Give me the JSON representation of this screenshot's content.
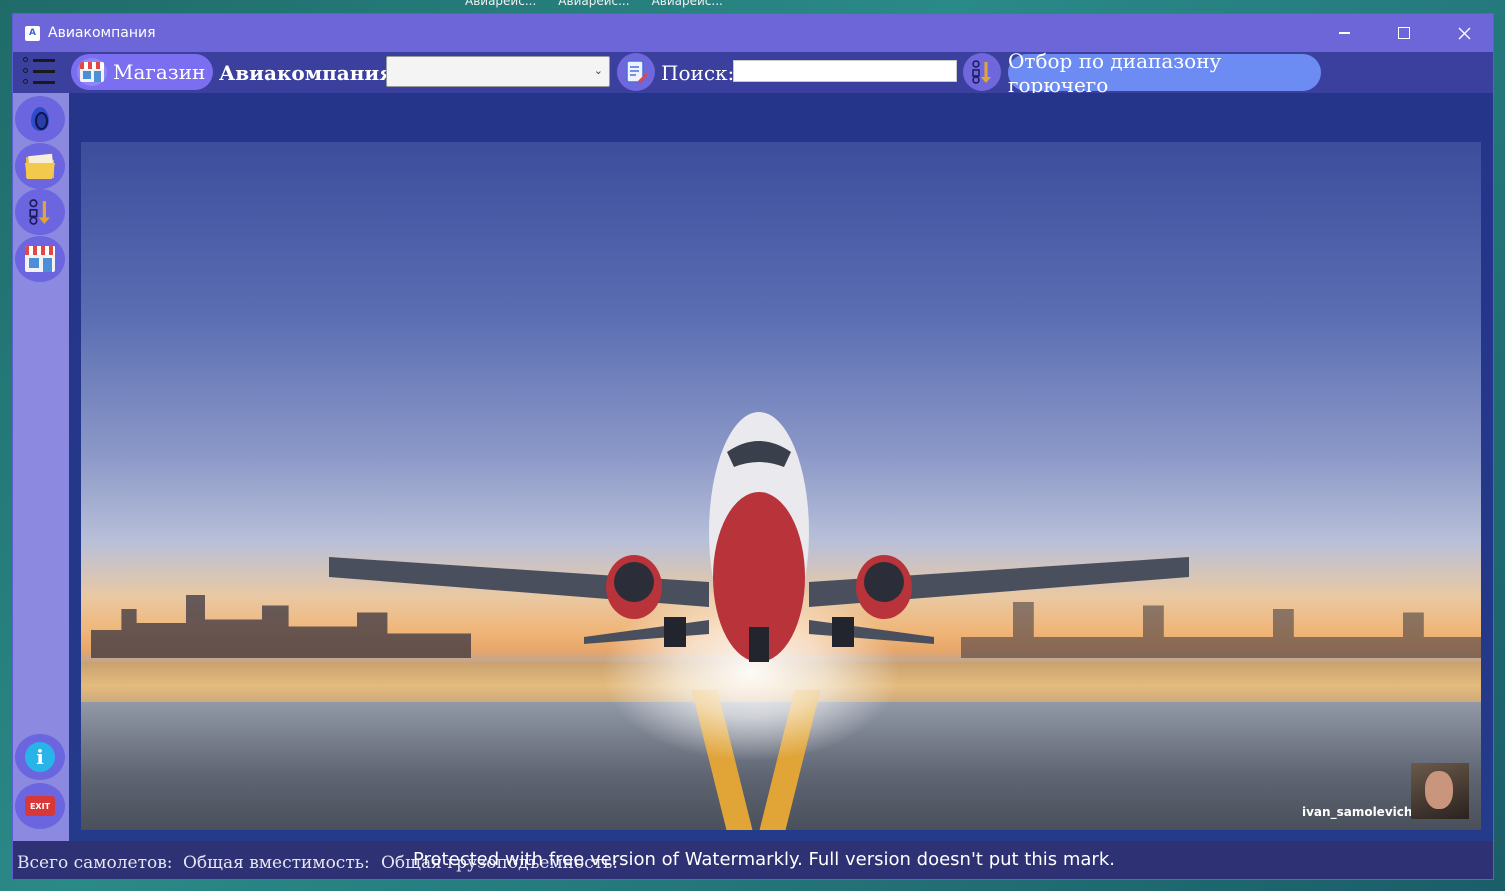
{
  "desktop": {
    "taskbar_tabs": [
      "Авиарейс...",
      "Авиарейс...",
      "Авиарейс..."
    ]
  },
  "window": {
    "title": "Авиакомпания",
    "app_icon_glyph": "A"
  },
  "toolbar": {
    "shop_label": "Магазин",
    "airline_label": "Авиакомпания:",
    "airline_value": "",
    "search_label": "Поиск:",
    "search_value": "",
    "fuel_filter_label": "Отбор по диапазону горючего"
  },
  "sidebar": {
    "items": [
      {
        "icon": "fuel-drop-icon"
      },
      {
        "icon": "folder-icon"
      },
      {
        "icon": "sort-filter-icon"
      },
      {
        "icon": "store-icon"
      }
    ],
    "bottom": [
      {
        "icon": "info-icon",
        "glyph": "i"
      },
      {
        "icon": "exit-icon",
        "glyph": "EXIT"
      }
    ]
  },
  "photo": {
    "credit": "ivan_samolevich"
  },
  "status": {
    "total_planes": "Всего самолетов:",
    "total_capacity": "Общая вместимость:",
    "total_cargo": "Общая грузоподъемность:",
    "watermark": "Protected with free version of Watermarkly. Full version doesn't put this mark."
  },
  "colors": {
    "titlebar": "#6c66d9",
    "toolbar": "#3b3f9e",
    "sidebar": "#8b8ae0",
    "pill": "#7c6ef0",
    "fuel_pill": "#6c8cf4"
  }
}
